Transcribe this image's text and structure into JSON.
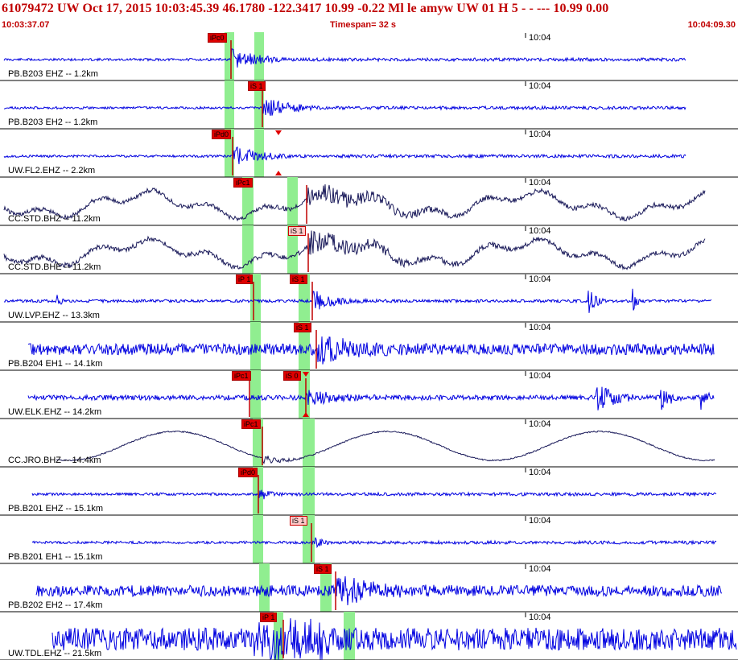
{
  "header": {
    "title": "61079472 UW Oct 17, 2015 10:03:45.39   46.1780 -122.3417 10.99 -0.22 Ml le    amyw    UW 01 H    5  -  - --- 10.99 0.00",
    "start_time": "10:03:37.07",
    "timespan": "Timespan=  32 s",
    "end_time": "10:04:09.30"
  },
  "colors": {
    "header_text": "#c00000",
    "trace_blue": "#0000e0",
    "trace_navy": "#1a1a5a",
    "phase_window": "#90ee90",
    "pick_dark": "#e00000",
    "pick_light": "#ffc8c8"
  },
  "channels": [
    {
      "label": "PB.B203 EHZ -- 1.2km",
      "time_mark": "10:04",
      "color": "blue",
      "picks": [
        {
          "text": "iPc0",
          "style": "dark"
        }
      ],
      "seed": 11
    },
    {
      "label": "PB.B203 EH2 -- 1.2km",
      "time_mark": "10:04",
      "color": "blue",
      "picks": [
        {
          "text": "iS 1",
          "style": "dark"
        }
      ],
      "seed": 23
    },
    {
      "label": "UW.FL2.EHZ -- 2.2km",
      "time_mark": "10:04",
      "color": "blue",
      "picks": [
        {
          "text": "iPd0",
          "style": "dark"
        }
      ],
      "seed": 37
    },
    {
      "label": "CC.STD.BHZ -- 11.2km",
      "time_mark": "10:04",
      "color": "navy",
      "picks": [
        {
          "text": "iPc1",
          "style": "dark"
        }
      ],
      "seed": 41
    },
    {
      "label": "CC.STD.BHE -- 11.2km",
      "time_mark": "10:04",
      "color": "navy",
      "picks": [
        {
          "text": "iS 1",
          "style": "light"
        }
      ],
      "seed": 53
    },
    {
      "label": "UW.LVP.EHZ -- 13.3km",
      "time_mark": "10:04",
      "color": "blue",
      "picks": [
        {
          "text": "iP 1",
          "style": "dark"
        },
        {
          "text": "iS 1",
          "style": "dark"
        }
      ],
      "seed": 67
    },
    {
      "label": "PB.B204 EH1 -- 14.1km",
      "time_mark": "10:04",
      "color": "blue",
      "picks": [
        {
          "text": "iS 1",
          "style": "dark"
        }
      ],
      "seed": 71
    },
    {
      "label": "UW.ELK.EHZ -- 14.2km",
      "time_mark": "10:04",
      "color": "blue",
      "picks": [
        {
          "text": "iPc1",
          "style": "dark"
        },
        {
          "text": "iS 0",
          "style": "dark"
        }
      ],
      "seed": 83
    },
    {
      "label": "CC.JRO.BHZ -- 14.4km",
      "time_mark": "10:04",
      "color": "navy",
      "picks": [
        {
          "text": "iPc1",
          "style": "dark"
        }
      ],
      "seed": 97
    },
    {
      "label": "PB.B201 EHZ -- 15.1km",
      "time_mark": "10:04",
      "color": "blue",
      "picks": [
        {
          "text": "iPd0",
          "style": "dark"
        }
      ],
      "seed": 101
    },
    {
      "label": "PB.B201 EH1 -- 15.1km",
      "time_mark": "10:04",
      "color": "blue",
      "picks": [
        {
          "text": "iS 1",
          "style": "light"
        }
      ],
      "seed": 113
    },
    {
      "label": "PB.B202 EH2 -- 17.4km",
      "time_mark": "10:04",
      "color": "blue",
      "picks": [
        {
          "text": "iS 1",
          "style": "dark"
        }
      ],
      "seed": 127
    },
    {
      "label": "UW.TDL.EHZ -- 21.5km",
      "time_mark": "10:04",
      "color": "blue",
      "picks": [
        {
          "text": "iP 1",
          "style": "dark"
        }
      ],
      "seed": 131
    }
  ]
}
